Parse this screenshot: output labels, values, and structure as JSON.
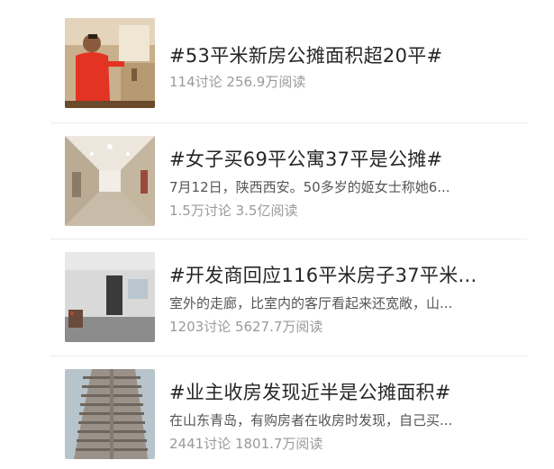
{
  "topics": [
    {
      "title": "#53平米新房公摊面积超20平#",
      "summary": "",
      "stats": "114讨论 256.9万阅读",
      "thumbnail": "man-in-red-jacket-in-kitchen"
    },
    {
      "title": "#女子买69平公寓37平是公摊#",
      "summary": "7月12日，陕西西安。50多岁的姬女士称她6...",
      "stats": "1.5万讨论 3.5亿阅读",
      "thumbnail": "long-empty-corridor"
    },
    {
      "title": "#开发商回应116平米房子37平米...",
      "summary": "室外的走廊，比室内的客厅看起来还宽敞，山...",
      "stats": "1203讨论 5627.7万阅读",
      "thumbnail": "empty-room-with-door"
    },
    {
      "title": "#业主收房发现近半是公摊面积#",
      "summary": "在山东青岛，有购房者在收房时发现，自己买...",
      "stats": "2441讨论 1801.7万阅读",
      "thumbnail": "high-rise-apartment-building"
    }
  ]
}
